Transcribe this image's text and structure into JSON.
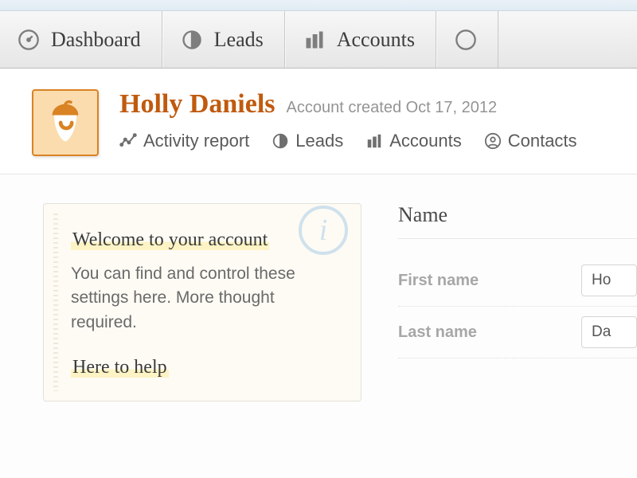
{
  "nav": {
    "items": [
      {
        "label": "Dashboard",
        "icon": "gauge-icon"
      },
      {
        "label": "Leads",
        "icon": "half-circle-icon"
      },
      {
        "label": "Accounts",
        "icon": "bars-icon"
      }
    ]
  },
  "account": {
    "name": "Holly Daniels",
    "created_label": "Account created Oct 17, 2012"
  },
  "sub_tabs": [
    {
      "label": "Activity report",
      "icon": "activity-icon"
    },
    {
      "label": "Leads",
      "icon": "half-circle-icon"
    },
    {
      "label": "Accounts",
      "icon": "bars-icon"
    },
    {
      "label": "Contacts",
      "icon": "person-circle-icon"
    }
  ],
  "help": {
    "heading1": "Welcome to your account",
    "body1": "You can find and control these settings here. More thought required.",
    "heading2": "Here to help"
  },
  "form": {
    "section_title": "Name",
    "rows": [
      {
        "label": "First name",
        "value": "Ho"
      },
      {
        "label": "Last name",
        "value": "Da"
      }
    ]
  }
}
